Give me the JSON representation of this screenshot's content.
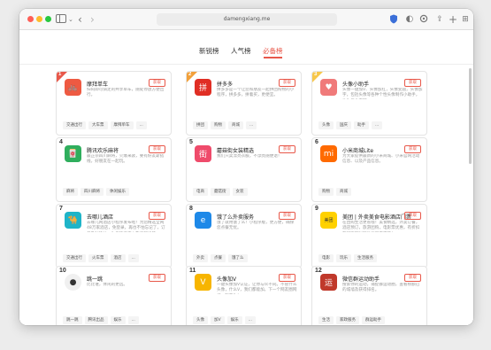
{
  "browser": {
    "address": "damengxiang.me"
  },
  "tabs": [
    {
      "label": "新锐榜"
    },
    {
      "label": "人气榜"
    },
    {
      "label": "必备榜"
    }
  ],
  "get_label": "获取",
  "more_label": "...",
  "cards": [
    {
      "rank": "1",
      "name": "摩拜单车",
      "desc": "扫码即可骑走的共享单车，随处停放方便出行。",
      "tags": [
        "交通出行",
        "大车票",
        "摩拜单车",
        "..."
      ],
      "icon": "mobike-icon",
      "color": "#ee5a42",
      "glyph": "🚲"
    },
    {
      "rank": "2",
      "name": "拼多多",
      "desc": "拼多多是一个让您和朋友一起拼团购物的小程序，拼多多，拼着买，更便宜。",
      "tags": [
        "拼团",
        "购物",
        "商城",
        "..."
      ],
      "icon": "pinduoduo-icon",
      "color": "#e02e24",
      "glyph": "拼"
    },
    {
      "rank": "3",
      "name": "头像小助手",
      "desc": "头像一键加V、头像加红，头像变圆，头像加字，包括头像等各种个性头像制作小助手，让你与众不同。",
      "tags": [
        "头像",
        "国庆",
        "助手",
        "..."
      ],
      "icon": "avatar-helper-icon",
      "color": "#f07a7a",
      "glyph": "♥"
    },
    {
      "rank": "4",
      "name": "腾讯欢乐麻将",
      "desc": "最正宗四川麻将，火爆来袭，要有好友斯搭线，好朋友在一起玩。",
      "tags": [
        "麻将",
        "四川麻将",
        "休闲娱乐"
      ],
      "icon": "mahjong-icon",
      "color": "#2fae5d",
      "glyph": "🀄"
    },
    {
      "rank": "5",
      "name": "蘑菇街女装精选",
      "desc": "我们只卖漂亮衣服，不漂亮随便退！",
      "tags": [
        "电商",
        "蘑菇街",
        "女装"
      ],
      "icon": "mogujie-icon",
      "color": "#ef4b6b",
      "glyph": "街"
    },
    {
      "rank": "6",
      "name": "小米商城Lite",
      "desc": "为大家提供最新的小米商城、小米官网活动信息、以及产品信息。",
      "tags": [
        "购物",
        "商城"
      ],
      "icon": "xiaomi-icon",
      "color": "#ff6a00",
      "glyph": "mi"
    },
    {
      "rank": "7",
      "name": "去哪儿酒店",
      "desc": "去哪儿网酒店小程序发布啦！为您精选全网48万家酒店，免登录，再也不怕忘记了，订单及时确认，为您的酒店之旅保驾护航~",
      "tags": [
        "交通出行",
        "火车票",
        "酒店",
        "..."
      ],
      "icon": "qunar-icon",
      "color": "#1fb4c8",
      "glyph": "🐪"
    },
    {
      "rank": "8",
      "name": "饿了么外卖服务",
      "desc": "饿了就用饿了么！小程序版，更方便，确保您点餐无忧。",
      "tags": [
        "外卖",
        "点餐",
        "饿了么"
      ],
      "icon": "eleme-icon",
      "color": "#1e89e8",
      "glyph": "e"
    },
    {
      "rank": "9",
      "name": "美团 | 外卖美食电影酒店门票",
      "desc": "在团购生活更省钱！美食精选，外卖订餐，酒店预订，旅游团购，电影票优惠，有折扣有团购随时随地享受不用等！",
      "tags": [
        "电影",
        "玩乐",
        "生活服务"
      ],
      "icon": "meituan-icon",
      "color": "#ffffff",
      "glyph": "美团"
    },
    {
      "rank": "10",
      "name": "跳一跳",
      "desc": "比比谁，体闲的更远。",
      "tags": [
        "跳一跳",
        "腾讯出品",
        "娱乐",
        "..."
      ],
      "icon": "jump-icon",
      "color": "#f4f4f4",
      "glyph": "●"
    },
    {
      "rank": "11",
      "name": "头像加V",
      "desc": "一键头像加V认证，让你与众不同。不管什么头像，什么V，我们都能加。下一个网友圈网红，就是你！",
      "tags": [
        "头像",
        "加V",
        "娱乐",
        "..."
      ],
      "icon": "avatar-v-icon",
      "color": "#f7b500",
      "glyph": "V"
    },
    {
      "rank": "12",
      "name": "微信群运动助手",
      "desc": "搜索你的运动，捕捉群运动圈，查看榜额已的城墙及获得排名。",
      "tags": [
        "生活",
        "家政服务",
        "群运助手"
      ],
      "icon": "group-sport-icon",
      "color": "#c0392b",
      "glyph": "运"
    }
  ]
}
